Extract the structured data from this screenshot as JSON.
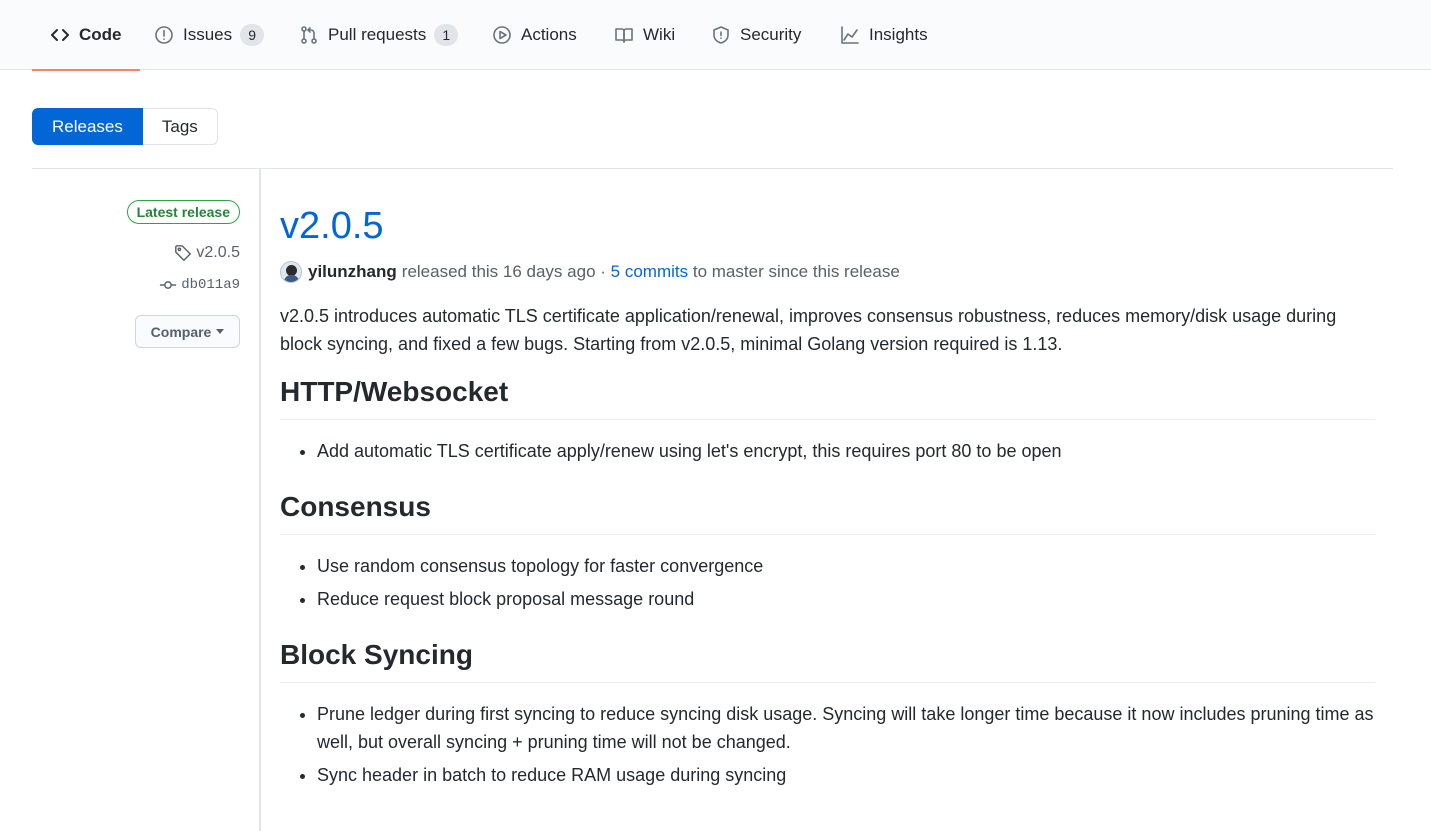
{
  "nav": {
    "tabs": [
      {
        "label": "Code",
        "icon": "code-icon",
        "selected": true
      },
      {
        "label": "Issues",
        "icon": "issue-icon",
        "count": "9"
      },
      {
        "label": "Pull requests",
        "icon": "pull-request-icon",
        "count": "1"
      },
      {
        "label": "Actions",
        "icon": "play-icon"
      },
      {
        "label": "Wiki",
        "icon": "book-icon"
      },
      {
        "label": "Security",
        "icon": "shield-icon"
      },
      {
        "label": "Insights",
        "icon": "graph-icon"
      }
    ],
    "accent_color": "#f9826c"
  },
  "subnav": {
    "releases": "Releases",
    "tags": "Tags"
  },
  "sidebar": {
    "latest_label": "Latest release",
    "tag": "v2.0.5",
    "commit": "db011a9",
    "compare": "Compare"
  },
  "release": {
    "title": "v2.0.5",
    "author": "yilunzhang",
    "released_text": "released this 16 days ago",
    "separator": "·",
    "commits_link": "5 commits",
    "commits_suffix": "to master since this release",
    "intro": "v2.0.5 introduces automatic TLS certificate application/renewal, improves consensus robustness, reduces memory/disk usage during block syncing, and fixed a few bugs. Starting from v2.0.5, minimal Golang version required is 1.13.",
    "sections": [
      {
        "heading": "HTTP/Websocket",
        "items": [
          "Add automatic TLS certificate apply/renew using let's encrypt, this requires port 80 to be open"
        ]
      },
      {
        "heading": "Consensus",
        "items": [
          "Use random consensus topology for faster convergence",
          "Reduce request block proposal message round"
        ]
      },
      {
        "heading": "Block Syncing",
        "items": [
          "Prune ledger during first syncing to reduce syncing disk usage. Syncing will take longer time because it now includes pruning time as well, but overall syncing + pruning time will not be changed.",
          "Sync header in batch to reduce RAM usage during syncing"
        ]
      }
    ]
  },
  "colors": {
    "link": "#0366d6",
    "latest_green": "#28a745"
  }
}
